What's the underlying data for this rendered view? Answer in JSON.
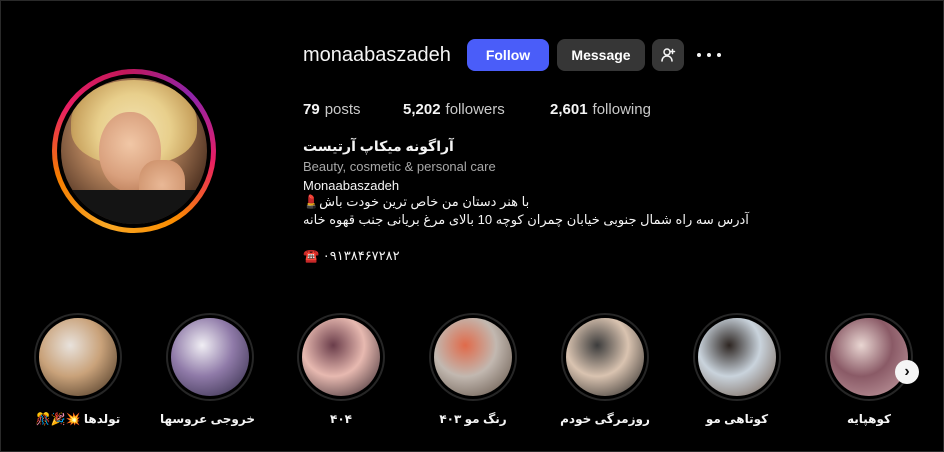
{
  "profile": {
    "username": "monaabaszadeh",
    "follow_label": "Follow",
    "message_label": "Message",
    "suggest_icon": "person-add-icon",
    "more_icon": "more-options-icon",
    "stats": {
      "posts_count": "79",
      "posts_label": "posts",
      "followers_count": "5,202",
      "followers_label": "followers",
      "following_count": "2,601",
      "following_label": "following"
    },
    "bio": {
      "display_name": "آراگونه میکاپ آرتیست",
      "category": "Beauty, cosmetic & personal care",
      "handle": "Monaabaszadeh",
      "line1": "با هنر دستان من خاص ترین خودت باش💄",
      "line2": "آدرس سه راه شمال جنوبی خیابان چمران کوچه 10 بالای مرغ بریانی جنب قهوه خانه",
      "phone": "☎️ ۰۹۱۳۸۴۶۷۲۸۲"
    }
  },
  "highlights": [
    {
      "label": "تولدها 💥🎉🎊",
      "colors": [
        "#3b2a1a",
        "#c9a27a",
        "#e8e2dc"
      ]
    },
    {
      "label": "خروجی عروسها",
      "colors": [
        "#2b2540",
        "#8f7aa8",
        "#f0eef4"
      ]
    },
    {
      "label": "۴۰۴",
      "colors": [
        "#2a1c24",
        "#e7b9b0",
        "#6a3d4a"
      ]
    },
    {
      "label": "رنگ مو ۴۰۳",
      "colors": [
        "#5a4a3e",
        "#c2b8b0",
        "#e06a4a"
      ]
    },
    {
      "label": "روزمرگی خودم",
      "colors": [
        "#1a1a1a",
        "#d9c3b0",
        "#3c3c3c"
      ]
    },
    {
      "label": "کوتاهی مو",
      "colors": [
        "#6b5444",
        "#c9d3dc",
        "#2e2622"
      ]
    },
    {
      "label": "کوهپایه",
      "colors": [
        "#c7a1a6",
        "#8a5a66",
        "#e9d6d2"
      ]
    }
  ],
  "carousel": {
    "next_icon": "chevron-right-icon",
    "next_glyph": "›"
  }
}
